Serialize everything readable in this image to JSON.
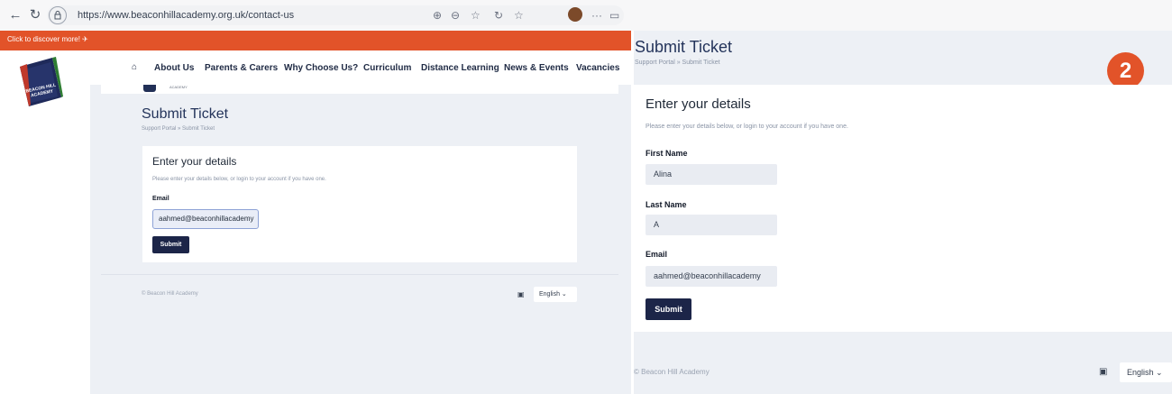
{
  "browser": {
    "url": "https://www.beaconhillacademy.org.uk/contact-us",
    "tool_icons": [
      "zoom-icon",
      "zoom-out-icon",
      "favorite-icon",
      "refresh-icon",
      "collections-icon",
      "profile-icon",
      "more-icon",
      "sidebar-icon"
    ]
  },
  "left": {
    "banner": "Click to discover more! ✈",
    "logo_text": "BEACON HILL ACADEMY",
    "nav": [
      "About Us",
      "Parents & Carers",
      "Why Choose Us?",
      "Curriculum",
      "Distance Learning",
      "News & Events",
      "Vacancies"
    ],
    "crest_text": "ACADEMY",
    "title": "Submit Ticket",
    "breadcrumb": "Support Portal  »  Submit Ticket",
    "card_title": "Enter your details",
    "card_desc": "Please enter your details below, or login to your account if you have one.",
    "email_label": "Email",
    "email_value": "aahmed@beaconhillacademy",
    "submit": "Submit",
    "footer": "© Beacon Hill Academy",
    "language": "English ⌄"
  },
  "right": {
    "title": "Submit Ticket",
    "breadcrumb": "Support Portal  »  Submit Ticket",
    "step": "2",
    "card_title": "Enter your details",
    "card_desc": "Please enter your details below, or login to your account if you have one.",
    "fields": [
      {
        "label": "First Name",
        "value": "Alina"
      },
      {
        "label": "Last Name",
        "value": "A"
      },
      {
        "label": "Email",
        "value": "aahmed@beaconhillacademy"
      }
    ],
    "submit": "Submit",
    "footer": "© Beacon Hill Academy",
    "language": "English ⌄"
  },
  "colors": {
    "accent": "#e25329",
    "navy": "#1c2548",
    "portal_bg": "#edf0f5"
  }
}
